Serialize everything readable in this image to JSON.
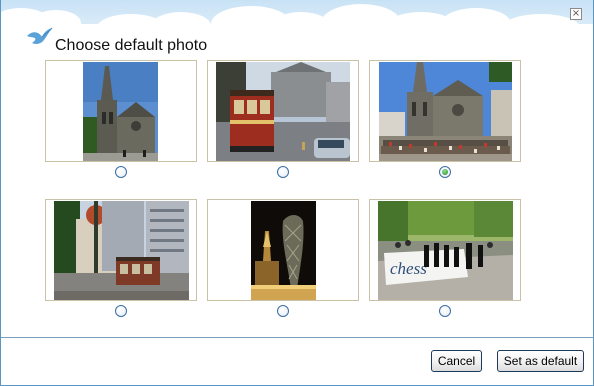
{
  "dialog": {
    "title": "Choose default photo",
    "close_glyph": "×",
    "icon": "bird-logo-icon"
  },
  "photos": [
    {
      "subject": "cathedral-spire-photo",
      "selected": false
    },
    {
      "subject": "tram-street-photo",
      "selected": false
    },
    {
      "subject": "cathedral-square-crowd-photo",
      "selected": true
    },
    {
      "subject": "tram-city-street-photo",
      "selected": false
    },
    {
      "subject": "night-sculpture-photo",
      "selected": false
    },
    {
      "subject": "giant-chess-board-photo",
      "selected": false
    }
  ],
  "buttons": {
    "cancel_label": "Cancel",
    "default_label": "Set as default"
  }
}
